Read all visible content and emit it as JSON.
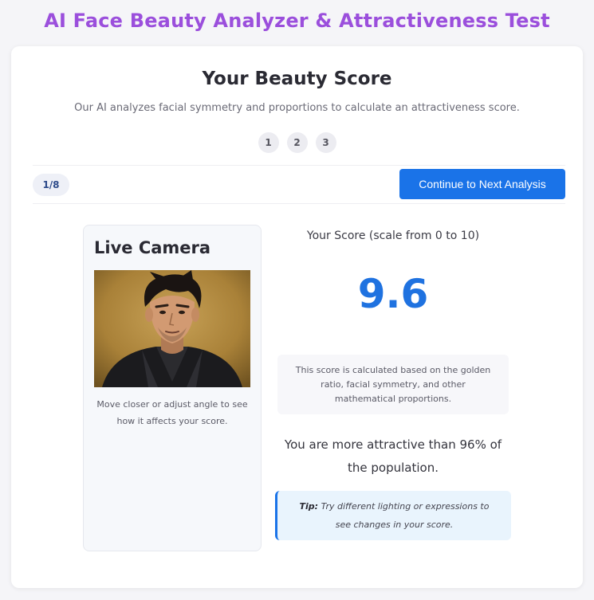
{
  "app": {
    "title": "AI Face Beauty Analyzer & Attractiveness Test"
  },
  "header": {
    "title": "Your Beauty Score",
    "subtitle": "Our AI analyzes facial symmetry and proportions to calculate an attractiveness score."
  },
  "steps": [
    "1",
    "2",
    "3"
  ],
  "toolbar": {
    "counter": "1/8",
    "next_label": "Continue to Next Analysis"
  },
  "camera": {
    "title": "Live Camera",
    "hint": "Move closer or adjust angle to see how it affects your score."
  },
  "score": {
    "label": "Your Score (scale from 0 to 10)",
    "value": "9.6",
    "info": "This score is calculated based on the golden ratio, facial symmetry, and other mathematical proportions.",
    "percentile": "You are more attractive than 96% of the population."
  },
  "tip": {
    "label": "Tip:",
    "text": "Try different lighting or expressions to see changes in your score."
  },
  "colors": {
    "title": "#9b4fdc",
    "accent": "#1a73e8",
    "score": "#1f72e0"
  },
  "icons": {
    "camera_feed": "portrait-image"
  }
}
